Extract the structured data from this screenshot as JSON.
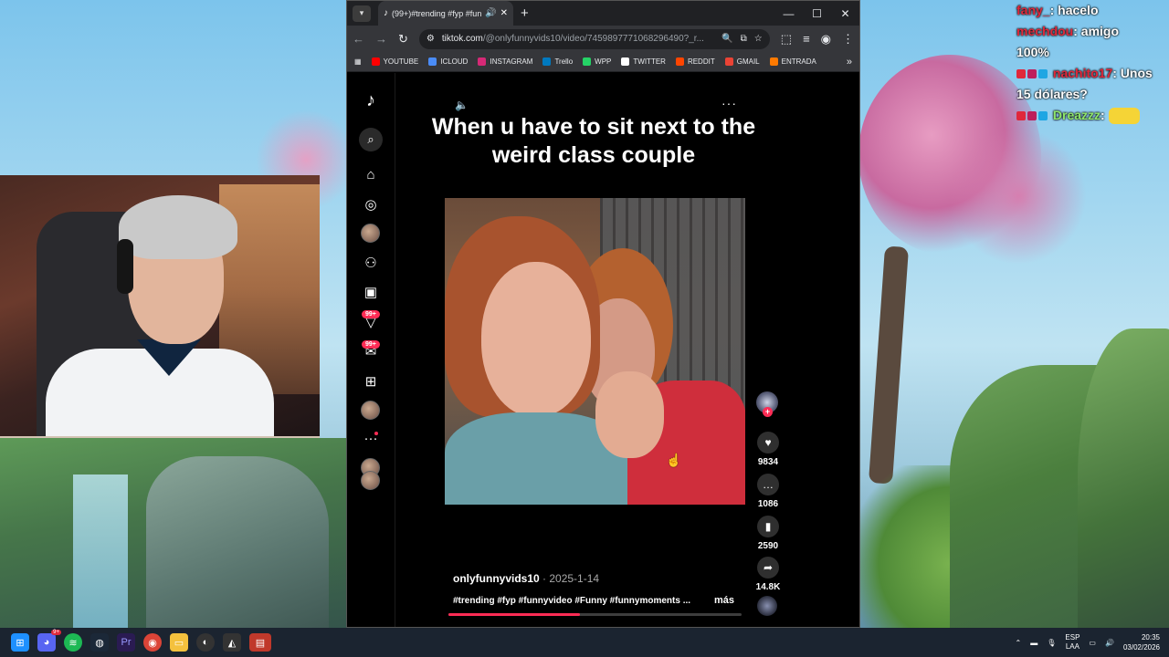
{
  "chat": {
    "lines": [
      {
        "user": "fany_",
        "text": "hacelo"
      },
      {
        "user": "mechdou",
        "text": "amigo"
      },
      {
        "user": "",
        "text": "100%"
      },
      {
        "user": "nachito17",
        "text": "Unos"
      },
      {
        "user": "",
        "text": "15 dólares?"
      },
      {
        "user": "Dreazzz",
        "text": ""
      }
    ]
  },
  "browser": {
    "tab_title": "(99+)#trending #fyp #funny",
    "url_host": "tiktok.com",
    "url_path": "/@onlyfunnyvids10/video/7459897771068296490?_r...",
    "bookmarks": [
      "YOUTUBE",
      "ICLOUD",
      "INSTAGRAM",
      "Trello",
      "WPP",
      "TWITTER",
      "REDDIT",
      "GMAIL",
      "ENTRADA"
    ],
    "bookmark_overflow": "»",
    "bookmark_colors": [
      "#ff0000",
      "#4a8cf7",
      "#d62976",
      "#0079bf",
      "#25d366",
      "#ffffff",
      "#ff4500",
      "#ea4335",
      "#ff7a00"
    ]
  },
  "tiktok": {
    "badge_1": "99+",
    "badge_2": "99+",
    "video_title": "When u have to sit next to the weird class couple",
    "likes": "9834",
    "comments": "1086",
    "saves": "2590",
    "shares": "14.8K",
    "username": "onlyfunnyvids10",
    "date_sep": " · ",
    "date": "2025-1-14",
    "hashtags": "#trending #fyp #funnyvideo #Funny #funnymoments ...",
    "more_label": "más",
    "progress": 0.45,
    "accent_color": "#fe2c55"
  },
  "taskbar": {
    "discord_badge": "9+",
    "lang_top": "ESP",
    "lang_bottom": "LAA",
    "time": "20:35",
    "date": "03/02/2026"
  }
}
